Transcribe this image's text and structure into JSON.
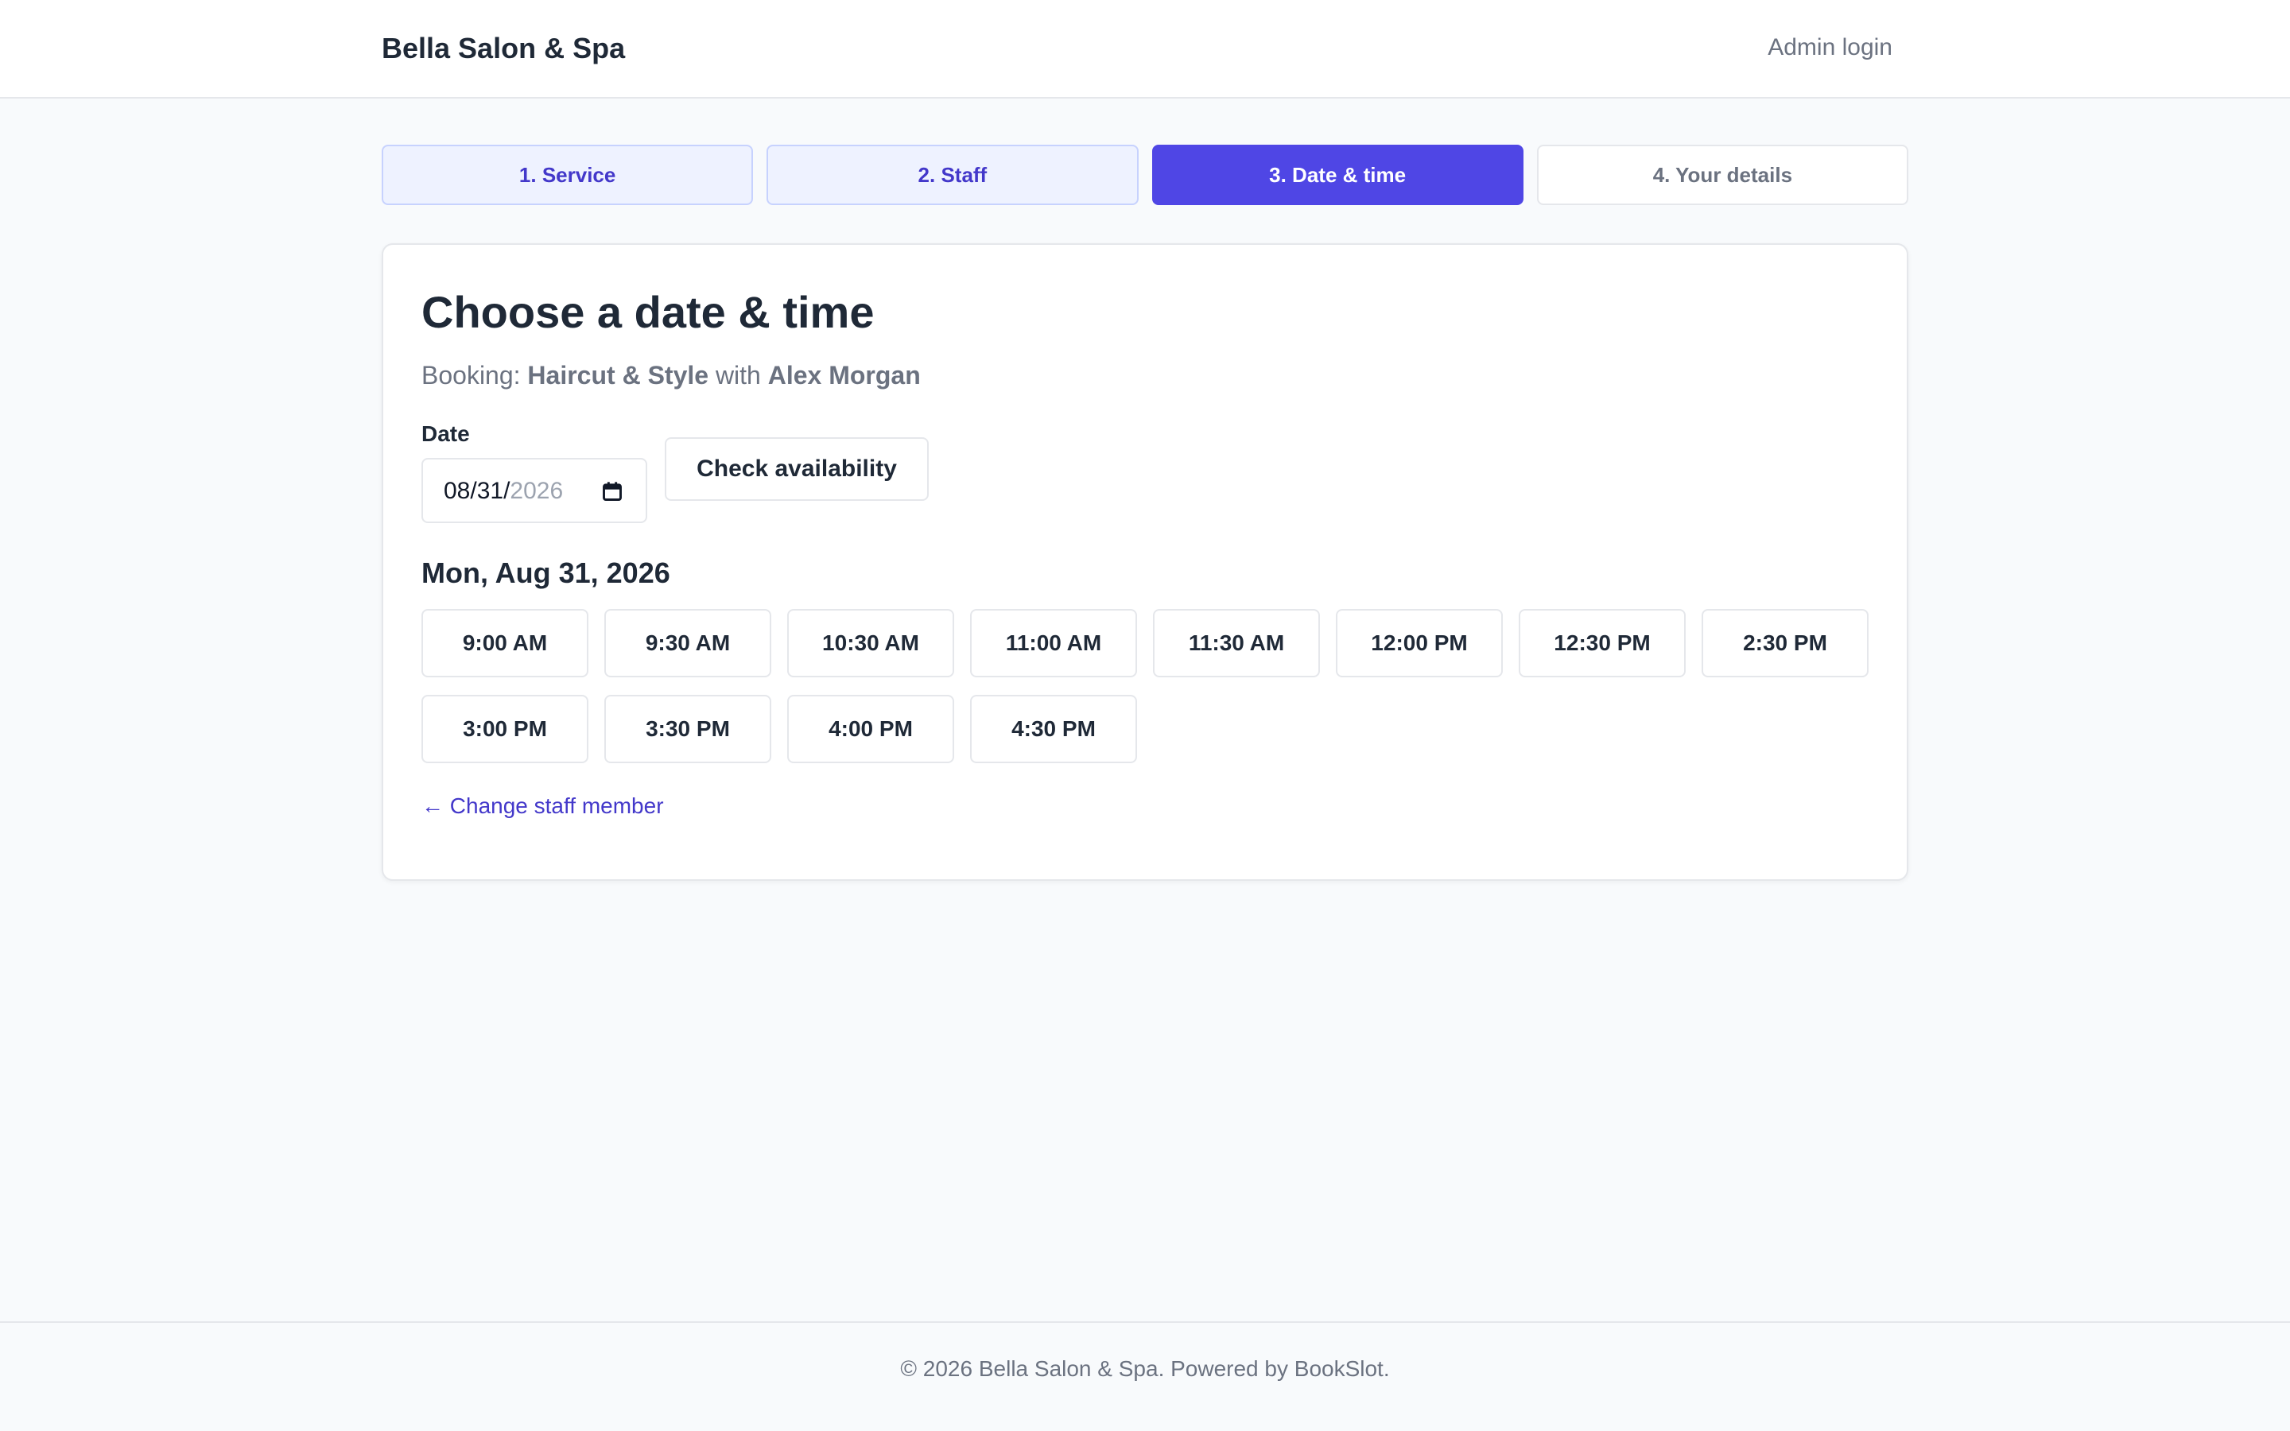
{
  "header": {
    "brand": "Bella Salon & Spa",
    "admin_link": "Admin login"
  },
  "steps": [
    {
      "label": "1. Service",
      "state": "done"
    },
    {
      "label": "2. Staff",
      "state": "done"
    },
    {
      "label": "3. Date & time",
      "state": "active"
    },
    {
      "label": "4. Your details",
      "state": "todo"
    }
  ],
  "main": {
    "title": "Choose a date & time",
    "booking_prefix": "Booking:",
    "service": "Haircut & Style",
    "with_word": "with",
    "staff": "Alex Morgan",
    "date_label": "Date",
    "date_value_md": "08/31/",
    "date_value_year": "2026",
    "check_button": "Check availability",
    "selected_date": "Mon, Aug 31, 2026",
    "time_slots": [
      "9:00 AM",
      "9:30 AM",
      "10:30 AM",
      "11:00 AM",
      "11:30 AM",
      "12:00 PM",
      "12:30 PM",
      "2:30 PM",
      "3:00 PM",
      "3:30 PM",
      "4:00 PM",
      "4:30 PM"
    ],
    "change_staff_link": "← Change staff member"
  },
  "footer": {
    "text": "© 2026 Bella Salon & Spa. Powered by BookSlot."
  },
  "colors": {
    "accent": "#4f46e5",
    "accent_text": "#4338ca",
    "step_done_bg": "#eef2ff"
  },
  "icons": {
    "date_picker": "calendar-icon"
  }
}
